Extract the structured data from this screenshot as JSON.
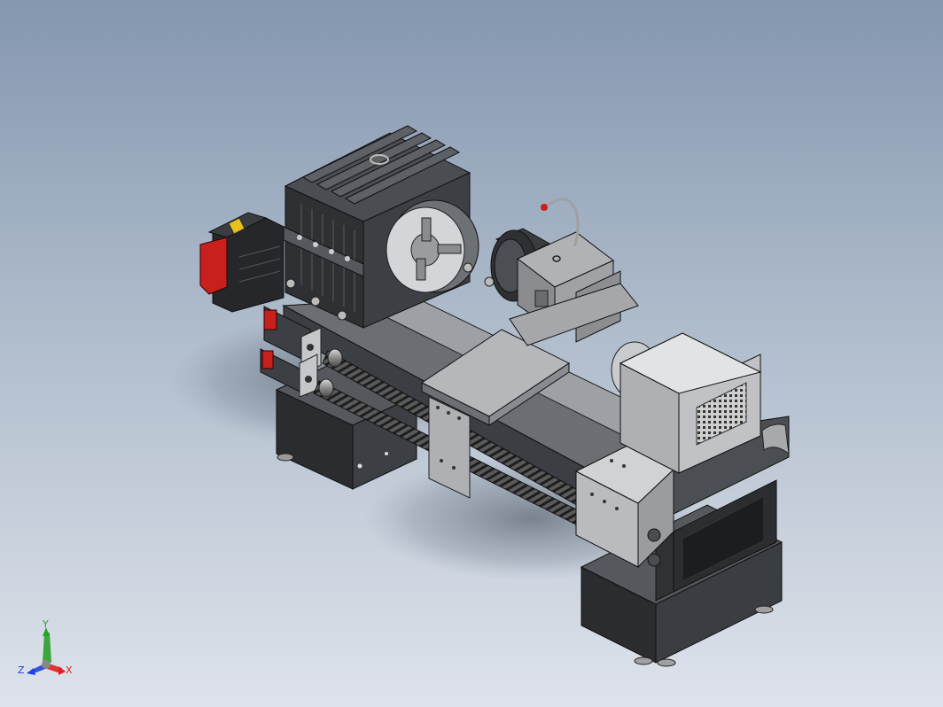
{
  "triad": {
    "x_label": "X",
    "y_label": "Y",
    "z_label": "Z",
    "x_color": "#e02020",
    "y_color": "#2aa02a",
    "z_color": "#2040e0"
  },
  "colors": {
    "background_top": "#8596b0",
    "background_bottom": "#dee3eb",
    "body_dark": "#2b2d30",
    "body_mid": "#4a4d52",
    "metal_light": "#c9cbcd",
    "motor_red": "#c8201c"
  }
}
